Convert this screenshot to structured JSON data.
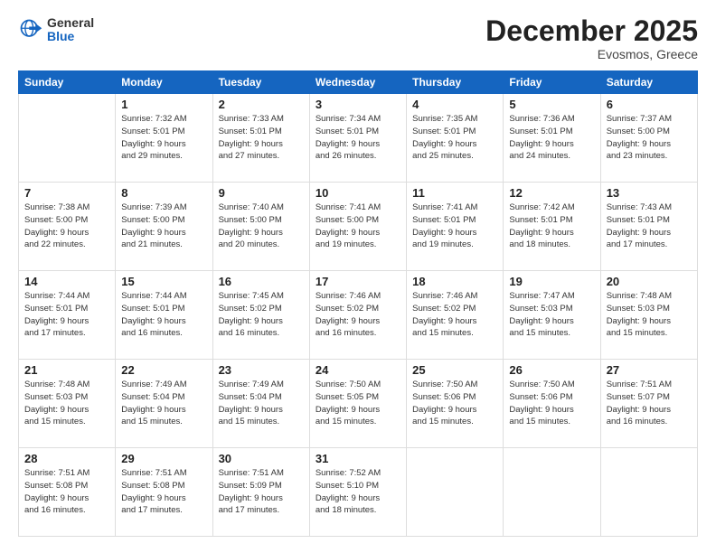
{
  "header": {
    "logo_line1": "General",
    "logo_line2": "Blue",
    "month": "December 2025",
    "location": "Evosmos, Greece"
  },
  "weekdays": [
    "Sunday",
    "Monday",
    "Tuesday",
    "Wednesday",
    "Thursday",
    "Friday",
    "Saturday"
  ],
  "weeks": [
    [
      {
        "day": "",
        "detail": ""
      },
      {
        "day": "1",
        "detail": "Sunrise: 7:32 AM\nSunset: 5:01 PM\nDaylight: 9 hours\nand 29 minutes."
      },
      {
        "day": "2",
        "detail": "Sunrise: 7:33 AM\nSunset: 5:01 PM\nDaylight: 9 hours\nand 27 minutes."
      },
      {
        "day": "3",
        "detail": "Sunrise: 7:34 AM\nSunset: 5:01 PM\nDaylight: 9 hours\nand 26 minutes."
      },
      {
        "day": "4",
        "detail": "Sunrise: 7:35 AM\nSunset: 5:01 PM\nDaylight: 9 hours\nand 25 minutes."
      },
      {
        "day": "5",
        "detail": "Sunrise: 7:36 AM\nSunset: 5:01 PM\nDaylight: 9 hours\nand 24 minutes."
      },
      {
        "day": "6",
        "detail": "Sunrise: 7:37 AM\nSunset: 5:00 PM\nDaylight: 9 hours\nand 23 minutes."
      }
    ],
    [
      {
        "day": "7",
        "detail": "Sunrise: 7:38 AM\nSunset: 5:00 PM\nDaylight: 9 hours\nand 22 minutes."
      },
      {
        "day": "8",
        "detail": "Sunrise: 7:39 AM\nSunset: 5:00 PM\nDaylight: 9 hours\nand 21 minutes."
      },
      {
        "day": "9",
        "detail": "Sunrise: 7:40 AM\nSunset: 5:00 PM\nDaylight: 9 hours\nand 20 minutes."
      },
      {
        "day": "10",
        "detail": "Sunrise: 7:41 AM\nSunset: 5:00 PM\nDaylight: 9 hours\nand 19 minutes."
      },
      {
        "day": "11",
        "detail": "Sunrise: 7:41 AM\nSunset: 5:01 PM\nDaylight: 9 hours\nand 19 minutes."
      },
      {
        "day": "12",
        "detail": "Sunrise: 7:42 AM\nSunset: 5:01 PM\nDaylight: 9 hours\nand 18 minutes."
      },
      {
        "day": "13",
        "detail": "Sunrise: 7:43 AM\nSunset: 5:01 PM\nDaylight: 9 hours\nand 17 minutes."
      }
    ],
    [
      {
        "day": "14",
        "detail": "Sunrise: 7:44 AM\nSunset: 5:01 PM\nDaylight: 9 hours\nand 17 minutes."
      },
      {
        "day": "15",
        "detail": "Sunrise: 7:44 AM\nSunset: 5:01 PM\nDaylight: 9 hours\nand 16 minutes."
      },
      {
        "day": "16",
        "detail": "Sunrise: 7:45 AM\nSunset: 5:02 PM\nDaylight: 9 hours\nand 16 minutes."
      },
      {
        "day": "17",
        "detail": "Sunrise: 7:46 AM\nSunset: 5:02 PM\nDaylight: 9 hours\nand 16 minutes."
      },
      {
        "day": "18",
        "detail": "Sunrise: 7:46 AM\nSunset: 5:02 PM\nDaylight: 9 hours\nand 15 minutes."
      },
      {
        "day": "19",
        "detail": "Sunrise: 7:47 AM\nSunset: 5:03 PM\nDaylight: 9 hours\nand 15 minutes."
      },
      {
        "day": "20",
        "detail": "Sunrise: 7:48 AM\nSunset: 5:03 PM\nDaylight: 9 hours\nand 15 minutes."
      }
    ],
    [
      {
        "day": "21",
        "detail": "Sunrise: 7:48 AM\nSunset: 5:03 PM\nDaylight: 9 hours\nand 15 minutes."
      },
      {
        "day": "22",
        "detail": "Sunrise: 7:49 AM\nSunset: 5:04 PM\nDaylight: 9 hours\nand 15 minutes."
      },
      {
        "day": "23",
        "detail": "Sunrise: 7:49 AM\nSunset: 5:04 PM\nDaylight: 9 hours\nand 15 minutes."
      },
      {
        "day": "24",
        "detail": "Sunrise: 7:50 AM\nSunset: 5:05 PM\nDaylight: 9 hours\nand 15 minutes."
      },
      {
        "day": "25",
        "detail": "Sunrise: 7:50 AM\nSunset: 5:06 PM\nDaylight: 9 hours\nand 15 minutes."
      },
      {
        "day": "26",
        "detail": "Sunrise: 7:50 AM\nSunset: 5:06 PM\nDaylight: 9 hours\nand 15 minutes."
      },
      {
        "day": "27",
        "detail": "Sunrise: 7:51 AM\nSunset: 5:07 PM\nDaylight: 9 hours\nand 16 minutes."
      }
    ],
    [
      {
        "day": "28",
        "detail": "Sunrise: 7:51 AM\nSunset: 5:08 PM\nDaylight: 9 hours\nand 16 minutes."
      },
      {
        "day": "29",
        "detail": "Sunrise: 7:51 AM\nSunset: 5:08 PM\nDaylight: 9 hours\nand 17 minutes."
      },
      {
        "day": "30",
        "detail": "Sunrise: 7:51 AM\nSunset: 5:09 PM\nDaylight: 9 hours\nand 17 minutes."
      },
      {
        "day": "31",
        "detail": "Sunrise: 7:52 AM\nSunset: 5:10 PM\nDaylight: 9 hours\nand 18 minutes."
      },
      {
        "day": "",
        "detail": ""
      },
      {
        "day": "",
        "detail": ""
      },
      {
        "day": "",
        "detail": ""
      }
    ]
  ]
}
